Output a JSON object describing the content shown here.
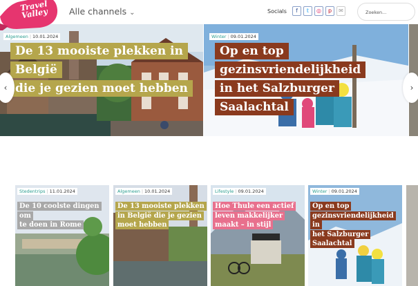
{
  "header": {
    "logo_text": "Travel Valley",
    "channels_label": "Alle channels",
    "socials_label": "Socials",
    "social_icons": [
      "facebook-icon",
      "twitter-icon",
      "instagram-icon",
      "pinterest-icon",
      "mail-icon"
    ],
    "search_placeholder": "Zoeken..."
  },
  "colors": {
    "brand_pink": "#e6356f",
    "olive_highlight": "#b5a64c",
    "brown_highlight": "#8a3a1e",
    "pink_highlight": "#e8708d",
    "teal_category": "#2a9d8f"
  },
  "hero": {
    "slides": [
      {
        "category": "Algemeen",
        "date": "10.01.2024",
        "title_lines": [
          "De 13 mooiste plekken in België",
          "die je gezien moet hebben"
        ]
      },
      {
        "category": "Winter",
        "date": "09.01.2024",
        "title_lines": [
          "Op en top gezinsvriendelijkheid",
          "in het Salzburger Saalachtal"
        ]
      }
    ],
    "prev_arrow": "‹",
    "next_arrow": "›"
  },
  "cards": [
    {
      "category": "Stedentrips",
      "date": "11.01.2024",
      "title_lines": [
        "De 10 coolste dingen om",
        "te doen in Rome"
      ]
    },
    {
      "category": "Algemeen",
      "date": "10.01.2024",
      "title_lines": [
        "De 13 mooiste plekken",
        "in België die je gezien",
        "moet hebben"
      ]
    },
    {
      "category": "Lifestyle",
      "date": "09.01.2024",
      "title_lines": [
        "Hoe Thule een actief",
        "leven makkelijker",
        "maakt – in stijl"
      ]
    },
    {
      "category": "Winter",
      "date": "09.01.2024",
      "title_lines": [
        "Op en top",
        "gezinsvriendelijkheid in",
        "het Salzburger",
        "Saalachtal"
      ]
    }
  ]
}
